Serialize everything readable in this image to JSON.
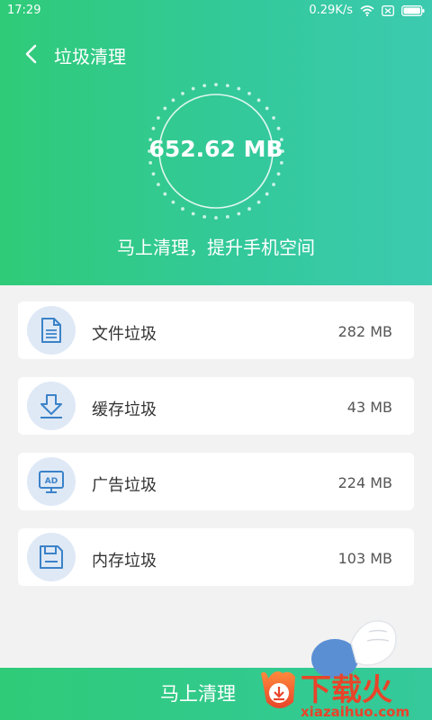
{
  "status_bar": {
    "time": "17:29",
    "speed": "0.29K/s"
  },
  "nav": {
    "title": "垃圾清理"
  },
  "summary": {
    "total_size": "652.62 MB",
    "slogan": "马上清理，提升手机空间"
  },
  "items": [
    {
      "label": "文件垃圾",
      "size": "282 MB",
      "icon": "document-icon"
    },
    {
      "label": "缓存垃圾",
      "size": "43 MB",
      "icon": "download-icon"
    },
    {
      "label": "广告垃圾",
      "size": "224 MB",
      "icon": "ad-icon"
    },
    {
      "label": "内存垃圾",
      "size": "103 MB",
      "icon": "floppy-icon"
    }
  ],
  "action": {
    "clean_label": "马上清理"
  },
  "watermark": {
    "text": "下载火",
    "domain": "xiazaihuo.com"
  },
  "colors": {
    "accent_start": "#2fcb78",
    "accent_end": "#3ccab0",
    "icon_blue": "#3b82c8",
    "icon_bg": "#dfe9f6"
  }
}
